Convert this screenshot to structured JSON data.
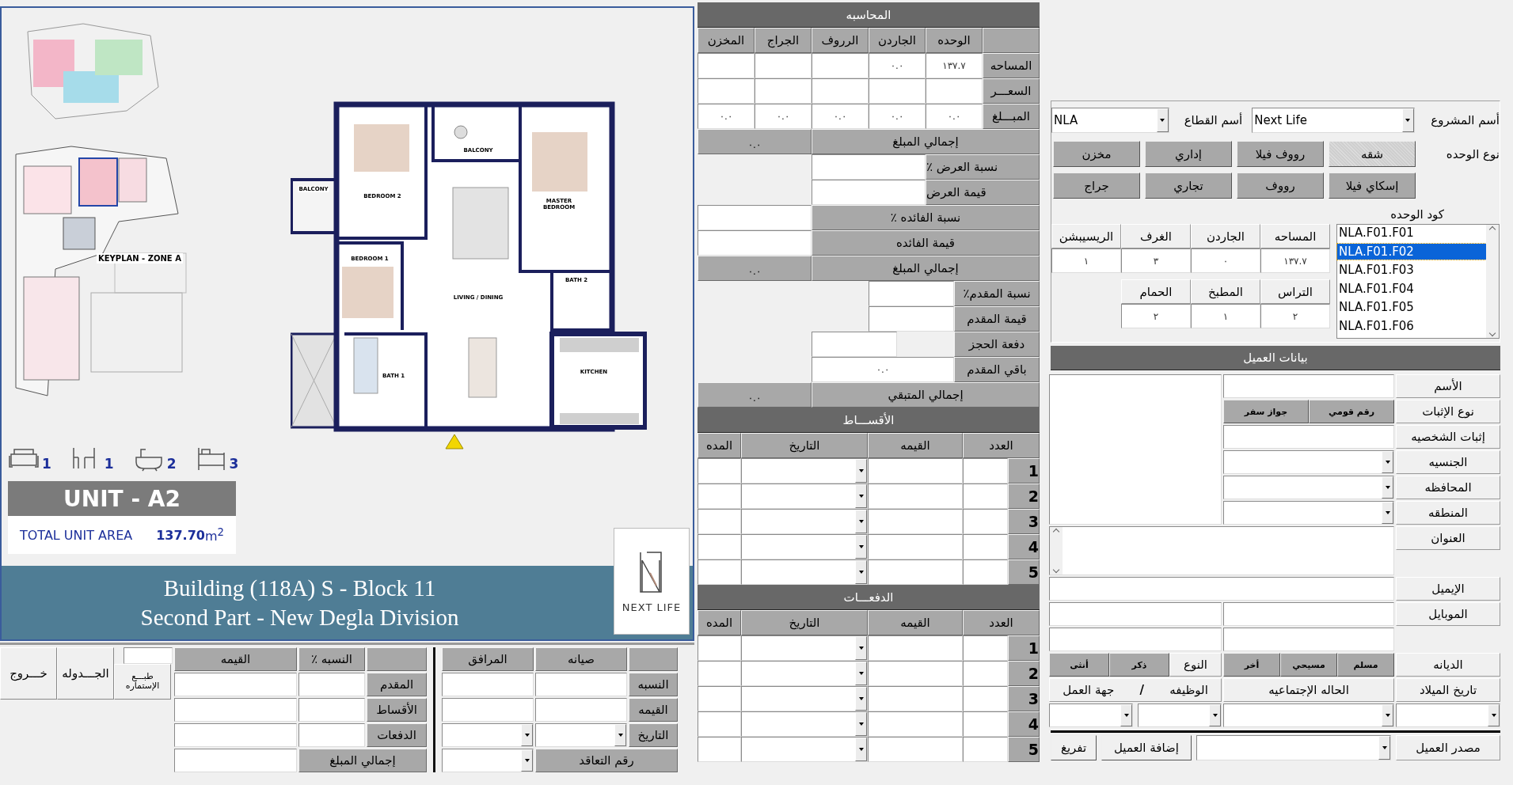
{
  "plan": {
    "keyplan_label": "KEYPLAN - ZONE A",
    "rooms": [
      "BALCONY",
      "BEDROOM 2",
      "BALCONY",
      "MASTER BEDROOM",
      "BEDROOM 1",
      "LIVING / DINING",
      "BATH 2",
      "BATH 1",
      "KITCHEN"
    ],
    "amenities": [
      {
        "kind": "bed",
        "count": "3"
      },
      {
        "kind": "bath",
        "count": "2"
      },
      {
        "kind": "dining",
        "count": "1"
      },
      {
        "kind": "sofa",
        "count": "1"
      }
    ],
    "unit_title": "UNIT - A2",
    "area_label": "TOTAL UNIT AREA",
    "area_value": "137.70",
    "area_unit": "m$^{2}$",
    "building_lines": [
      "Building (118A) S - Block 11",
      "Second Part - New Degla Division"
    ],
    "logo_text": "NEXT LIFE"
  },
  "accounting": {
    "title": "المحاسبه",
    "columns": [
      "الوحده",
      "الجاردن",
      "الرروف",
      "الجراج",
      "المخزن"
    ],
    "rows": [
      {
        "label": "المساحه",
        "values": [
          "١٣٧.٧",
          "٠.٠"
        ]
      },
      {
        "label": "السعـــر"
      },
      {
        "label": "المبـــلغ",
        "values": [
          "٠.٠",
          "٠.٠",
          "٠.٠",
          "٠.٠",
          "٠.٠"
        ]
      }
    ],
    "total": {
      "label": "إجمالي المبلغ",
      "value": "٠.٠"
    },
    "offer": [
      "نسبة العرض ٪",
      "قيمة العرض"
    ],
    "interest": [
      "نسبة الفائده ٪",
      "قيمة الفائده"
    ],
    "interest_total": {
      "label": "إجمالي المبلغ",
      "value": "٠.٠"
    },
    "down_payment": [
      {
        "label": "نسبة المقدم٪"
      },
      {
        "label": "قيمة المقدم"
      },
      {
        "label": "دفعة الحجز"
      },
      {
        "label": "باقي المقدم",
        "value": "٠.٠"
      }
    ],
    "remaining_total": {
      "label": "إجمالي المتبقي",
      "value": "٠.٠"
    },
    "installments": {
      "title": "الأقســـاط",
      "columns": [
        "العدد",
        "القيمه",
        "التاريخ",
        "المده"
      ],
      "rows": [
        "1",
        "2",
        "3",
        "4",
        "5"
      ]
    },
    "payments": {
      "title": "الدفعـــات",
      "columns": [
        "العدد",
        "القيمه",
        "التاريخ",
        "المده"
      ],
      "rows": [
        "1",
        "2",
        "3",
        "4",
        "5"
      ]
    }
  },
  "unit": {
    "project_label": "أسم المشروع",
    "project_value": "Next Life",
    "sector_label": "أسم القطاع",
    "sector_value": "NLA",
    "type_label": "نوع الوحده",
    "types": [
      {
        "label": "شقه",
        "selected": true
      },
      {
        "label": "رووف فيلا",
        "selected": false
      },
      {
        "label": "إداري",
        "selected": false
      },
      {
        "label": "مخزن",
        "selected": false
      },
      {
        "label": "إسكاي فيلا",
        "selected": false
      },
      {
        "label": "رووف",
        "selected": false
      },
      {
        "label": "تجاري",
        "selected": false
      },
      {
        "label": "جراج",
        "selected": false
      }
    ],
    "code_label": "كود الوحده",
    "codes": [
      {
        "label": "NLA.F01.F01",
        "selected": false
      },
      {
        "label": "NLA.F01.F02",
        "selected": true
      },
      {
        "label": "NLA.F01.F03",
        "selected": false
      },
      {
        "label": "NLA.F01.F04",
        "selected": false
      },
      {
        "label": "NLA.F01.F05",
        "selected": false
      },
      {
        "label": "NLA.F01.F06",
        "selected": false
      }
    ],
    "specs": [
      {
        "label": "المساحه",
        "value": "١٣٧.٧"
      },
      {
        "label": "الجاردن",
        "value": "٠"
      },
      {
        "label": "الغرف",
        "value": "٣"
      },
      {
        "label": "الريسيبشن",
        "value": "١"
      },
      {
        "label": "التراس",
        "value": "٢"
      },
      {
        "label": "المطبخ",
        "value": "١"
      },
      {
        "label": "الحمام",
        "value": "٢"
      }
    ]
  },
  "client": {
    "title": "بيانات العميل",
    "name_label": "الأسم",
    "id_type": {
      "label": "نوع الإثبات",
      "options": [
        {
          "label": "رقم قومي",
          "selected": false
        },
        {
          "label": "جواز سفر",
          "selected": false
        }
      ]
    },
    "id_label": "إثبات الشخصيه",
    "nationality_label": "الجنسيه",
    "governorate_label": "المحافظه",
    "district_label": "المنطقه",
    "address_label": "العنوان",
    "email_label": "الإيميل",
    "mobile_label": "الموبايل",
    "religion": {
      "label": "الديانه",
      "options": [
        {
          "label": "مسلم",
          "selected": false
        },
        {
          "label": "مسيحي",
          "selected": false
        },
        {
          "label": "أخر",
          "selected": false
        }
      ]
    },
    "gender": {
      "label": "النوع",
      "options": [
        {
          "label": "ذكر",
          "selected": false
        },
        {
          "label": "أنثى",
          "selected": false
        }
      ]
    },
    "birth_label": "تاريخ الميلاد",
    "marital_label": "الحاله الإجتماعيه",
    "job_label": "الوظيفه",
    "job_separator": "/",
    "employer_label": "جهة العمل",
    "source_label": "مصدر العميل",
    "add_button": "إضافة العميل",
    "clear_button": "تفريغ"
  },
  "summary": {
    "exit_button": "خـــروج",
    "schedule_button": "الجـــدوله",
    "print_button": "طبـــع الإستماره",
    "payment_table": {
      "columns": [
        "النسبه ٪",
        "القيمه"
      ],
      "rows": [
        "المقدم",
        "الأقساط",
        "الدفعات"
      ],
      "total_label": "إجمالي المبلغ"
    },
    "maintenance_table": {
      "columns": [
        "صيانه",
        "المرافق"
      ],
      "rows": [
        "النسبه",
        "القيمه",
        "التاريخ"
      ],
      "contract_label": "رقم التعاقد"
    }
  }
}
